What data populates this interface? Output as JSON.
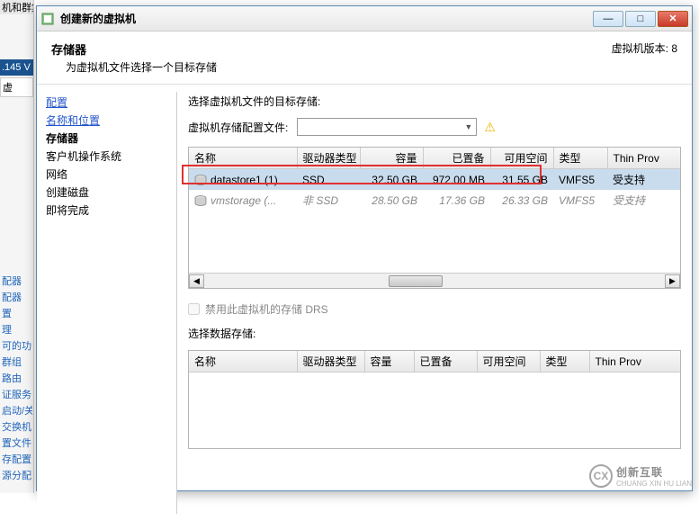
{
  "bg": {
    "top_text": "机和群集",
    "blue_strip": ".145 V",
    "tab": "虚",
    "links": [
      "配器",
      "配器",
      "置",
      "理",
      "可的功",
      "群组",
      "路由",
      "证服务",
      "启动/关",
      "交换机",
      "置文件",
      "存配置",
      "源分配"
    ]
  },
  "titlebar": {
    "title": "创建新的虚拟机",
    "minimize": "—",
    "maximize": "□",
    "close": "✕"
  },
  "header": {
    "title": "存储器",
    "subtitle": "为虚拟机文件选择一个目标存储",
    "version": "虚拟机版本: 8"
  },
  "nav": {
    "items": [
      {
        "label": "配置",
        "type": "link"
      },
      {
        "label": "名称和位置",
        "type": "link"
      },
      {
        "label": "存储器",
        "type": "current"
      },
      {
        "label": "客户机操作系统",
        "type": "plain"
      },
      {
        "label": "网络",
        "type": "plain"
      },
      {
        "label": "创建磁盘",
        "type": "plain"
      },
      {
        "label": "即将完成",
        "type": "plain"
      }
    ]
  },
  "content": {
    "select_target_label": "选择虚拟机文件的目标存储:",
    "profile_label": "虚拟机存储配置文件:",
    "profile_value": "",
    "checkbox_label": "禁用此虚拟机的存储 DRS",
    "select_datastore_label": "选择数据存储:"
  },
  "table1": {
    "cols": [
      "名称",
      "驱动器类型",
      "容量",
      "已置备",
      "可用空间",
      "类型",
      "Thin Prov"
    ],
    "rows": [
      {
        "name": "datastore1 (1)",
        "drive": "SSD",
        "capacity": "32.50 GB",
        "provisioned": "972.00 MB",
        "free": "31.55 GB",
        "type": "VMFS5",
        "thin": "受支持",
        "selected": true
      },
      {
        "name": "vmstorage (...",
        "drive": "非 SSD",
        "capacity": "28.50 GB",
        "provisioned": "17.36 GB",
        "free": "26.33 GB",
        "type": "VMFS5",
        "thin": "受支持",
        "disabled": true
      }
    ]
  },
  "table2": {
    "cols": [
      "名称",
      "驱动器类型",
      "容量",
      "已置备",
      "可用空间",
      "类型",
      "Thin Prov"
    ]
  },
  "watermark": {
    "logo": "CX",
    "text": "创新互联",
    "sub": "CHUANG XIN HU LIAN"
  }
}
